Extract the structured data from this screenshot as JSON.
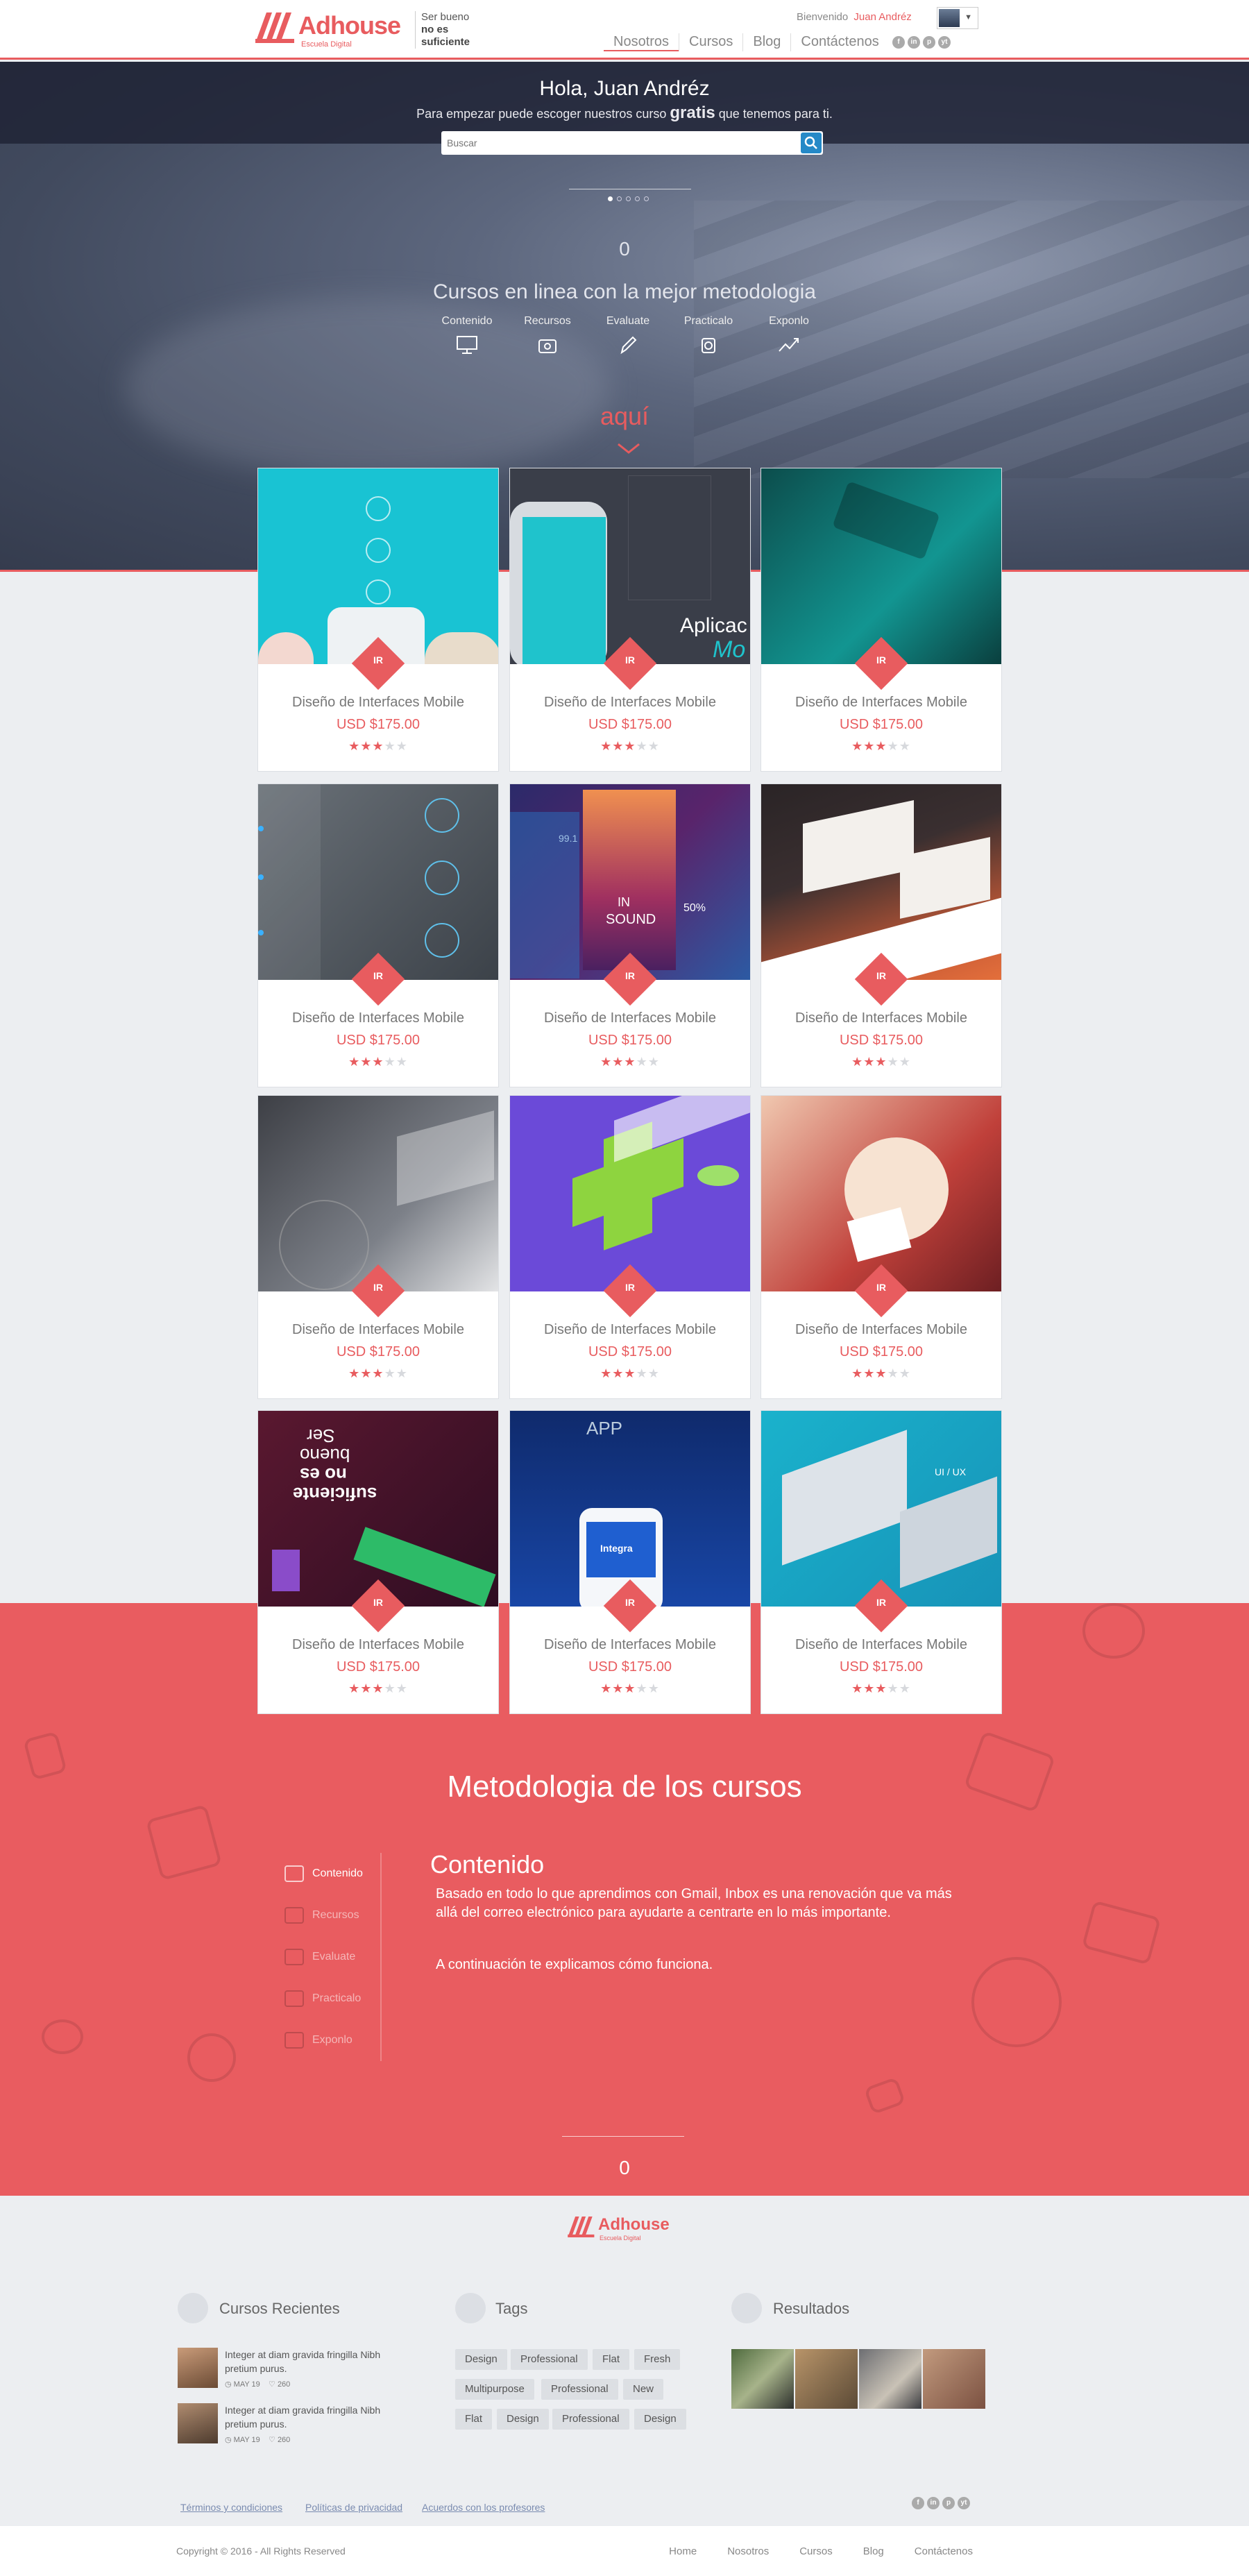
{
  "header": {
    "brand": "Adhouse",
    "brand_sub": "Escuela Digital",
    "tagline_1": "Ser bueno",
    "tagline_2": "no es",
    "tagline_3": "suficiente",
    "welcome": "Bienvenido",
    "user": "Juan Andréz",
    "nav": [
      "Nosotros",
      "Cursos",
      "Blog",
      "Contáctenos"
    ],
    "social": [
      "f",
      "in",
      "p",
      "yt"
    ]
  },
  "hero": {
    "title": "Hola, Juan Andréz",
    "subtitle_pre": "Para empezar puede escoger nuestros curso",
    "subtitle_bold": "gratis",
    "subtitle_post": "que tenemos para ti.",
    "search_placeholder": "Buscar",
    "count": "0",
    "headline": "Cursos en linea con la mejor metodologia",
    "features": [
      "Contenido",
      "Recursos",
      "Evaluate",
      "Practicalo",
      "Exponlo"
    ],
    "cta": "aquí"
  },
  "courses": {
    "items": [
      {
        "title": "Diseño de Interfaces Mobile",
        "price": "USD $175.00",
        "rating": 3,
        "ir": "IR"
      },
      {
        "title": "Diseño de Interfaces Mobile",
        "price": "USD $175.00",
        "rating": 3,
        "ir": "IR"
      },
      {
        "title": "Diseño de Interfaces Mobile",
        "price": "USD $175.00",
        "rating": 3,
        "ir": "IR"
      },
      {
        "title": "Diseño de Interfaces Mobile",
        "price": "USD $175.00",
        "rating": 3,
        "ir": "IR"
      },
      {
        "title": "Diseño de Interfaces Mobile",
        "price": "USD $175.00",
        "rating": 3,
        "ir": "IR"
      },
      {
        "title": "Diseño de Interfaces Mobile",
        "price": "USD $175.00",
        "rating": 3,
        "ir": "IR"
      },
      {
        "title": "Diseño de Interfaces Mobile",
        "price": "USD $175.00",
        "rating": 3,
        "ir": "IR"
      },
      {
        "title": "Diseño de Interfaces Mobile",
        "price": "USD $175.00",
        "rating": 3,
        "ir": "IR"
      },
      {
        "title": "Diseño de Interfaces Mobile",
        "price": "USD $175.00",
        "rating": 3,
        "ir": "IR"
      },
      {
        "title": "Diseño de Interfaces Mobile",
        "price": "USD $175.00",
        "rating": 3,
        "ir": "IR"
      },
      {
        "title": "Diseño de Interfaces Mobile",
        "price": "USD $175.00",
        "rating": 3,
        "ir": "IR"
      },
      {
        "title": "Diseño de Interfaces Mobile",
        "price": "USD $175.00",
        "rating": 3,
        "ir": "IR"
      }
    ],
    "image_labels": {
      "aplicacion": "Aplicac",
      "mo": "Mo",
      "insound_1": "IN",
      "insound_2": "SOUND",
      "val_99": "99.1",
      "val_50": "50%",
      "app": "APP",
      "integra": "Integra",
      "uiux": "UI / UX",
      "ser": "Ser",
      "bueno": "bueno",
      "no_es": "no es",
      "suficiente": "suficiente"
    }
  },
  "methodology": {
    "title": "Metodologia de los cursos",
    "items": [
      "Contenido",
      "Recursos",
      "Evaluate",
      "Practicalo",
      "Exponlo"
    ],
    "active_heading": "Contenido",
    "paragraph": "Basado en todo lo que aprendimos con Gmail, Inbox es una renovación que va más allá del correo electrónico para ayudarte a centrarte en lo más importante.",
    "paragraph2": "A continuación te explicamos cómo funciona.",
    "count": "0"
  },
  "footer": {
    "brand": "Adhouse",
    "brand_sub": "Escuela Digital",
    "recent_title": "Cursos Recientes",
    "posts": [
      {
        "text": "Integer at diam gravida fringilla Nibh pretium purus.",
        "date": "MAY 19",
        "likes": "260"
      },
      {
        "text": "Integer at diam gravida fringilla Nibh pretium purus.",
        "date": "MAY 19",
        "likes": "260"
      }
    ],
    "tags_title": "Tags",
    "tags": [
      "Design",
      "Professional",
      "Flat",
      "Fresh",
      "Multipurpose",
      "Professional",
      "New",
      "Flat",
      "Design",
      "Professional",
      "Design"
    ],
    "results_title": "Resultados",
    "links": [
      "Términos y condiciones",
      "Políticas de privacidad",
      "Acuerdos con los profesores"
    ],
    "copyright": "Copyright © 2016 - All Rights Reserved",
    "nav": [
      "Home",
      "Nosotros",
      "Cursos",
      "Blog",
      "Contáctenos"
    ]
  },
  "colors": {
    "accent": "#e85c5f",
    "hero_dark": "#3b4356",
    "section_red": "#e95c60",
    "bg": "#eceef1"
  }
}
